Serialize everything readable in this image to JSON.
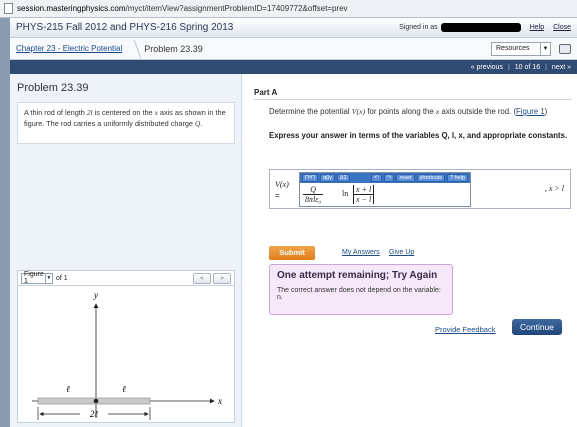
{
  "browser": {
    "url_prefix": "session.masteringphysics.com",
    "url_rest": "/myct/itemView?assignmentProblemID=17409772&offset=prev"
  },
  "header": {
    "course": "PHYS-215 Fall 2012 and PHYS-216 Spring 2013",
    "signed_in": "Signed in as",
    "help": "Help",
    "close": "Close"
  },
  "nav": {
    "chapter": "Chapter 23 - Electric Potential",
    "problem": "Problem 23.39",
    "resources": "Resources"
  },
  "pager": {
    "previous": "« previous",
    "position": "10 of 16",
    "next": "next »"
  },
  "problem": {
    "title": "Problem 23.39",
    "statement_1": "A thin rod of length ",
    "statement_var1": "2l",
    "statement_2": " is centered on the ",
    "statement_var2": "x",
    "statement_3": " axis as shown in the figure. The rod carries a uniformly distributed charge ",
    "statement_var3": "Q",
    "statement_4": "."
  },
  "figure_bar": {
    "selected": "Figure 1",
    "of": "of 1"
  },
  "figure": {
    "y_label": "y",
    "x_label": "x",
    "l_left": "ℓ",
    "l_right": "ℓ",
    "length": "2ℓ"
  },
  "part": {
    "label": "Part A",
    "question_1": "Determine the potential ",
    "question_var": "V(x)",
    "question_2": " for points along the ",
    "question_var2": "x",
    "question_3": " axis outside the rod. (",
    "figure_link": "Figure 1",
    "question_4": ")",
    "instructions": "Express your answer in terms of the variables Q, l, x, and appropriate constants."
  },
  "answer": {
    "lhs": "V(x)",
    "equals": "=",
    "numerator": "Q",
    "denominator": "8πlε₀",
    "ln": "ln",
    "abs_num": "x + l",
    "abs_den": "x − l",
    "condition": ", x > l",
    "toolbar": [
      "ΠⁿΠ",
      "αβγ",
      "ΔΣ",
      "↶",
      "↷",
      "reset",
      "shortcuts",
      "? help"
    ]
  },
  "actions": {
    "submit": "Submit",
    "my_answers": "My Answers",
    "give_up": "Give Up"
  },
  "feedback": {
    "title": "One attempt remaining; Try Again",
    "message": "The correct answer does not depend on the variable: n."
  },
  "footer": {
    "provide_feedback": "Provide Feedback",
    "continue": "Continue"
  }
}
